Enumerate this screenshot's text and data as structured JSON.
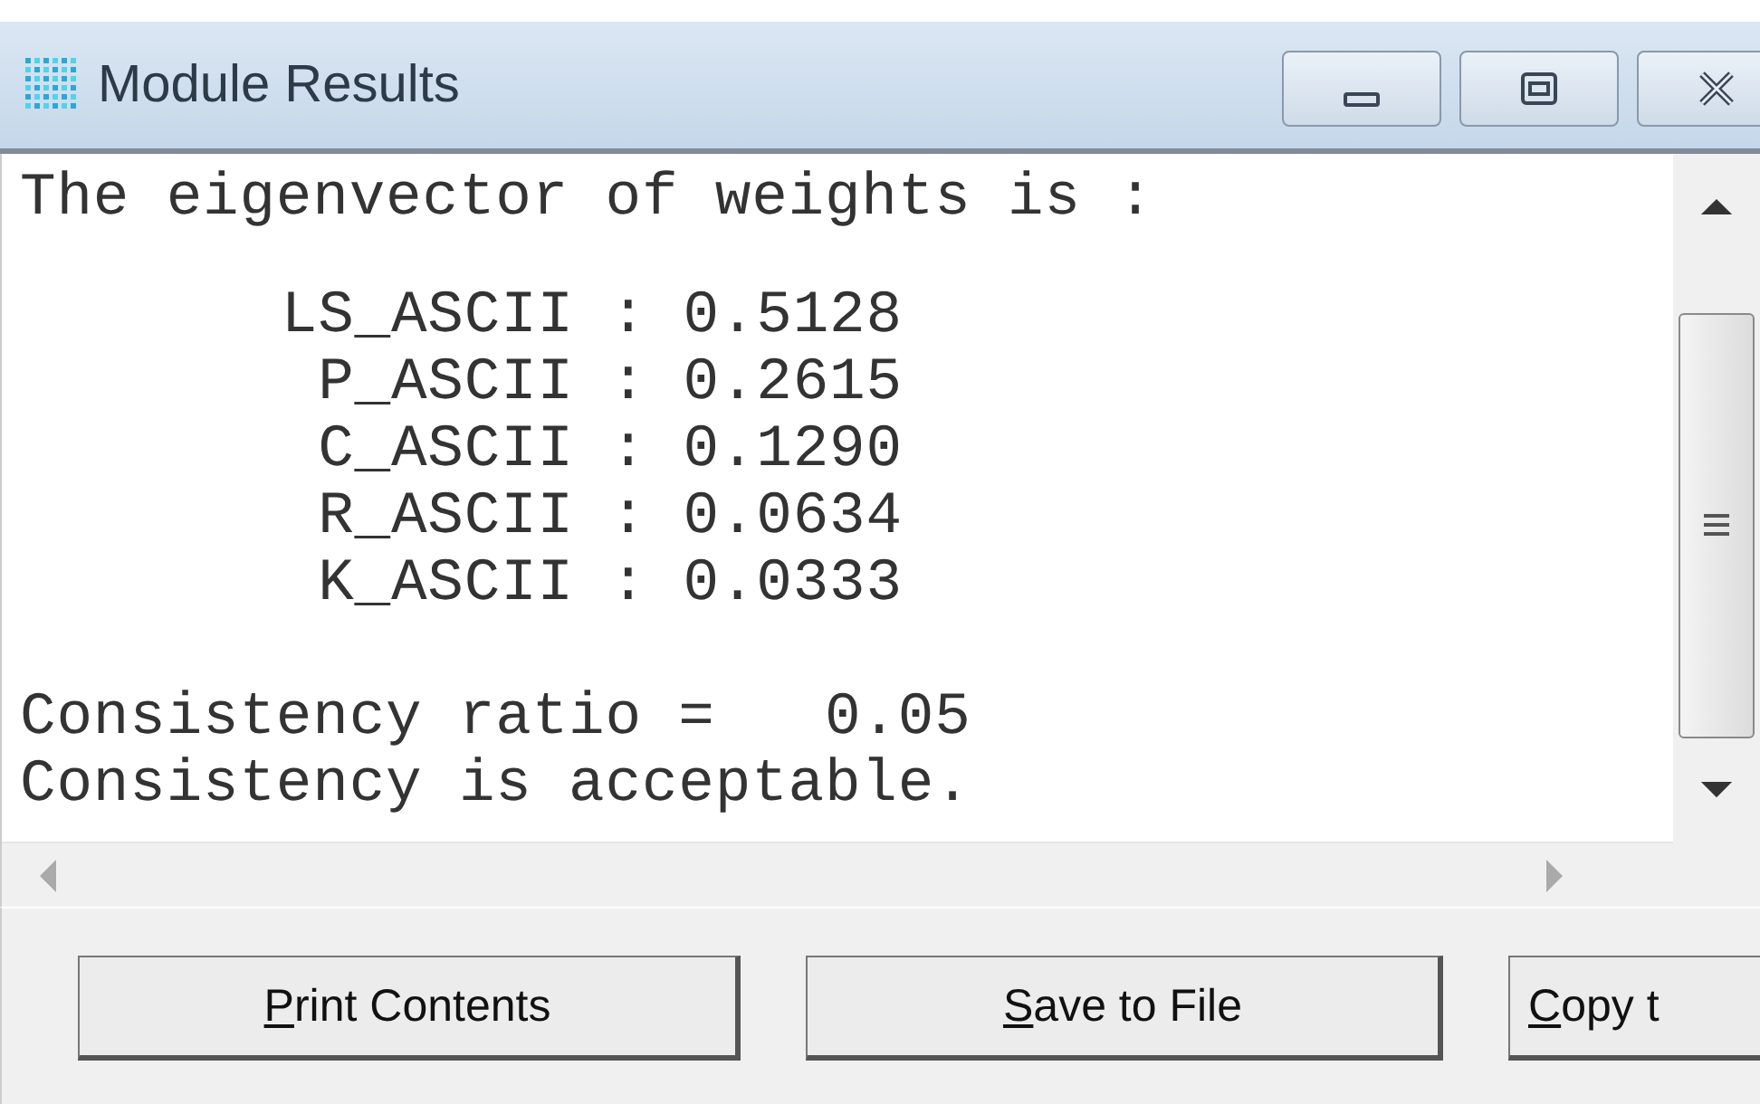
{
  "window": {
    "title": "Module Results"
  },
  "output": {
    "heading": "The eigenvector of weights is :",
    "weights": [
      {
        "name": "LS_ASCII",
        "separator": ":",
        "value": "0.5128"
      },
      {
        "name": "P_ASCII",
        "separator": ":",
        "value": "0.2615"
      },
      {
        "name": "C_ASCII",
        "separator": ":",
        "value": "0.1290"
      },
      {
        "name": "R_ASCII",
        "separator": ":",
        "value": "0.0634"
      },
      {
        "name": "K_ASCII",
        "separator": ":",
        "value": "0.0333"
      }
    ],
    "ratio": "Consistency ratio =   0.05",
    "verdict": "Consistency is acceptable."
  },
  "buttons": [
    {
      "access_key": "P",
      "label_rest": "rint Contents"
    },
    {
      "access_key": "S",
      "label_rest": "ave to File"
    },
    {
      "access_key": "C",
      "label_rest": "opy t"
    }
  ]
}
